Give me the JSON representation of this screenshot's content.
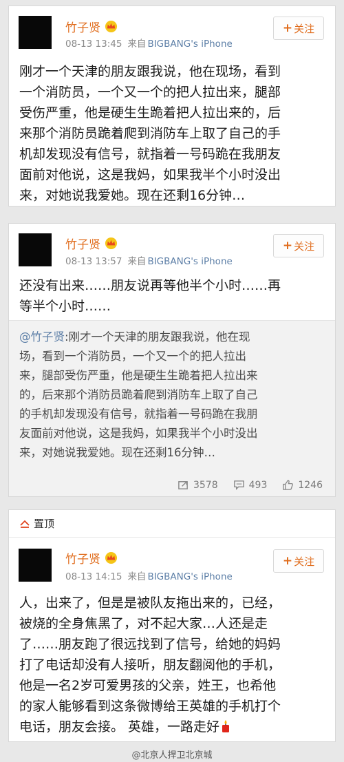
{
  "posts": [
    {
      "name": "竹子贤",
      "time": "08-13 13:45",
      "source_label": "来自",
      "device": "BIGBANG's iPhone",
      "follow_label": "关注",
      "text": "刚才一个天津的朋友跟我说，他在现场，看到\n一个消防员，一个又一个的把人拉出来，腿部\n受伤严重，他是硬生生跪着把人拉出来的，后\n来那个消防员跪着爬到消防车上取了自己的手\n机却发现没有信号，就指着一号码跪在我朋友\n面前对他说，这是我妈，如果我半个小时没出\n来，对她说我爱她。现在还剩16分钟…"
    },
    {
      "name": "竹子贤",
      "time": "08-13 13:57",
      "source_label": "来自",
      "device": "BIGBANG's iPhone",
      "follow_label": "关注",
      "text": "还没有出来……朋友说再等他半个小时……再\n等半个小时……",
      "repost": {
        "mention": "@竹子贤",
        "text": ":刚才一个天津的朋友跟我说，他在现\n场，看到一个消防员，一个又一个的把人拉出\n来，腿部受伤严重，他是硬生生跪着把人拉出来\n的，后来那个消防员跪着爬到消防车上取了自己\n的手机却发现没有信号，就指着一号码跪在我朋\n友面前对他说，这是我妈，如果我半个小时没出\n来，对她说我爱她。现在还剩16分钟…",
        "reposts": "3578",
        "comments": "493",
        "likes": "1246"
      }
    },
    {
      "pin_label": "置顶",
      "name": "竹子贤",
      "time": "08-13 14:15",
      "source_label": "来自",
      "device": "BIGBANG's iPhone",
      "follow_label": "关注",
      "text": "人，出来了，但是是被队友拖出来的，已经，\n被烧的全身焦黑了，对不起大家…人还是走\n了……朋友跑了很远找到了信号，给她的妈妈\n打了电话却没有人接听，朋友翻阅他的手机，\n他是一名2岁可爱男孩的父亲，姓王，也希他\n的家人能够看到这条微博给王英雄的手机打个\n电话，朋友会接。 英雄，一路走好"
    }
  ],
  "watermark": "@北京人捍卫北京城",
  "colors": {
    "name": "#e06c1c",
    "device": "#5d7fa7",
    "meta": "#8a8a8a",
    "background": "#e8e8e8"
  },
  "icons": [
    "vip-crown-icon",
    "plus-icon",
    "repost-icon",
    "comment-icon",
    "like-icon",
    "pin-icon",
    "candle-emoji-icon"
  ]
}
